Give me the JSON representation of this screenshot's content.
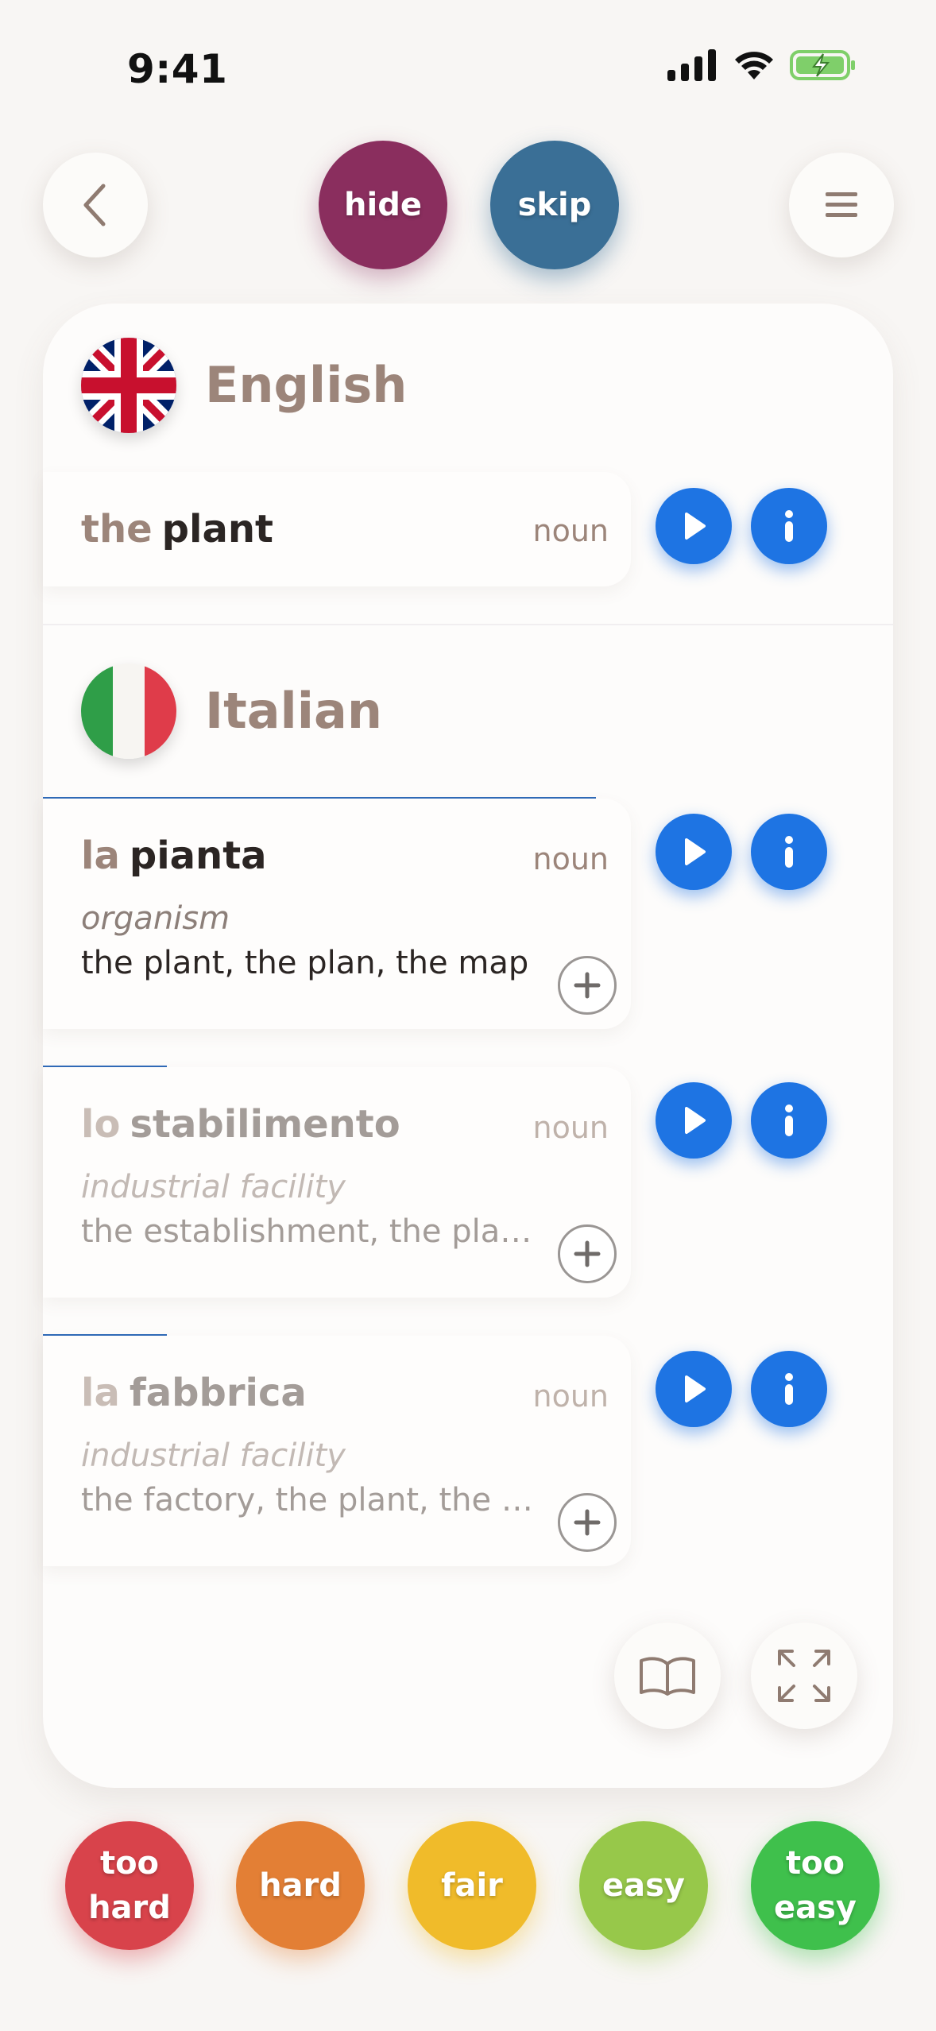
{
  "status": {
    "time": "9:41"
  },
  "top_buttons": {
    "hide": "hide",
    "skip": "skip"
  },
  "source": {
    "language": "English",
    "entry": {
      "article": "the",
      "word": "plant",
      "pos": "noun"
    }
  },
  "target": {
    "language": "Italian",
    "entries": [
      {
        "article": "la",
        "word": "pianta",
        "pos": "noun",
        "sense": "organism",
        "gloss": "the plant, the plan, the map",
        "progress": 0.58
      },
      {
        "article": "lo",
        "word": "stabilimento",
        "pos": "noun",
        "sense": "industrial facility",
        "gloss": "the establishment, the plant,...",
        "progress": 0.13
      },
      {
        "article": "la",
        "word": "fabbrica",
        "pos": "noun",
        "sense": "industrial facility",
        "gloss": "the factory, the plant, the wo...",
        "progress": 0.13
      }
    ]
  },
  "difficulty": {
    "too_hard": "too hard",
    "hard": "hard",
    "fair": "fair",
    "easy": "easy",
    "too_easy": "too easy"
  },
  "colors": {
    "hide": "#8a2e5e",
    "skip": "#3a6f96",
    "accent_blue": "#1e74e3",
    "too_hard": "#d8434b",
    "hard": "#e37f35",
    "fair": "#f0bb2a",
    "easy": "#97c84a",
    "too_easy": "#3fc04c"
  }
}
